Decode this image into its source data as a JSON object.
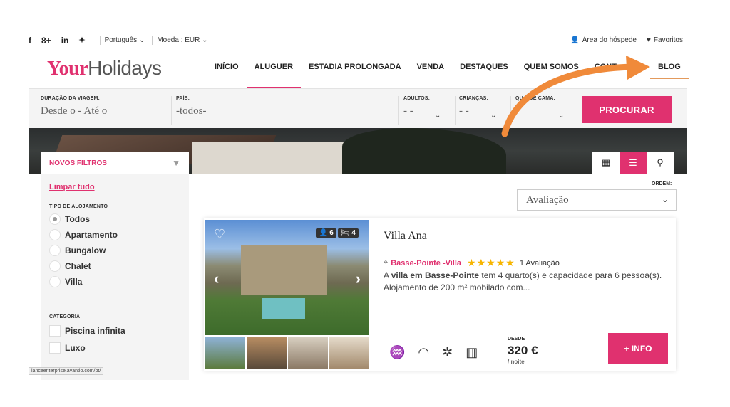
{
  "topbar": {
    "social": [
      "f",
      "8+",
      "in",
      "🐦"
    ],
    "language": "Português",
    "currency": "Moeda : EUR",
    "guest_area": "Área do hóspede",
    "favorites": "Favoritos"
  },
  "logo": {
    "bold": "Your",
    "light": "Holidays"
  },
  "nav": {
    "items": [
      "INÍCIO",
      "ALUGUER",
      "ESTADIA PROLONGADA",
      "VENDA",
      "DESTAQUES",
      "QUEM SOMOS",
      "CONT"
    ],
    "blog": "BLOG"
  },
  "search": {
    "duration_label": "DURAÇÃO DA VIAGEM:",
    "duration_value": "Desde o - Até o",
    "country_label": "PAÍS:",
    "country_value": "-todos-",
    "adults_label": "ADULTOS:",
    "adults_value": "- -",
    "children_label": "CRIANÇAS:",
    "children_value": "- -",
    "beds_label": "QU... DE CAMA:",
    "beds_value": "-",
    "button": "PROCURAR"
  },
  "sidebar": {
    "title": "NOVOS FILTROS",
    "clear": "Limpar tudo",
    "type_label": "TIPO DE ALOJAMENTO",
    "types": [
      "Todos",
      "Apartamento",
      "Bungalow",
      "Chalet",
      "Villa"
    ],
    "category_label": "CATEGORIA",
    "categories": [
      "Piscina infinita",
      "Luxo"
    ]
  },
  "sort": {
    "label": "ORDEM:",
    "value": "Avaliação"
  },
  "listing": {
    "name": "Villa Ana",
    "guests": "6",
    "rooms": "4",
    "location": "Basse-Pointe -Villa",
    "reviews": "1 Avaliação",
    "rating": 5,
    "desc_prefix": "A ",
    "desc_bold": "villa em Basse-Pointe",
    "desc_rest": " tem 4 quarto(s) e capacidade para 6 pessoa(s). Alojamento de 200 m² mobilado com...",
    "price_label": "DESDE",
    "price": "320 €",
    "price_unit": "/ noite",
    "info_button": "+ INFO"
  },
  "statusbar": "ianceenterprise.avantio.com/pt/",
  "colors": {
    "accent": "#e0316f",
    "arrow": "#f08a3a",
    "star": "#f7b500"
  }
}
